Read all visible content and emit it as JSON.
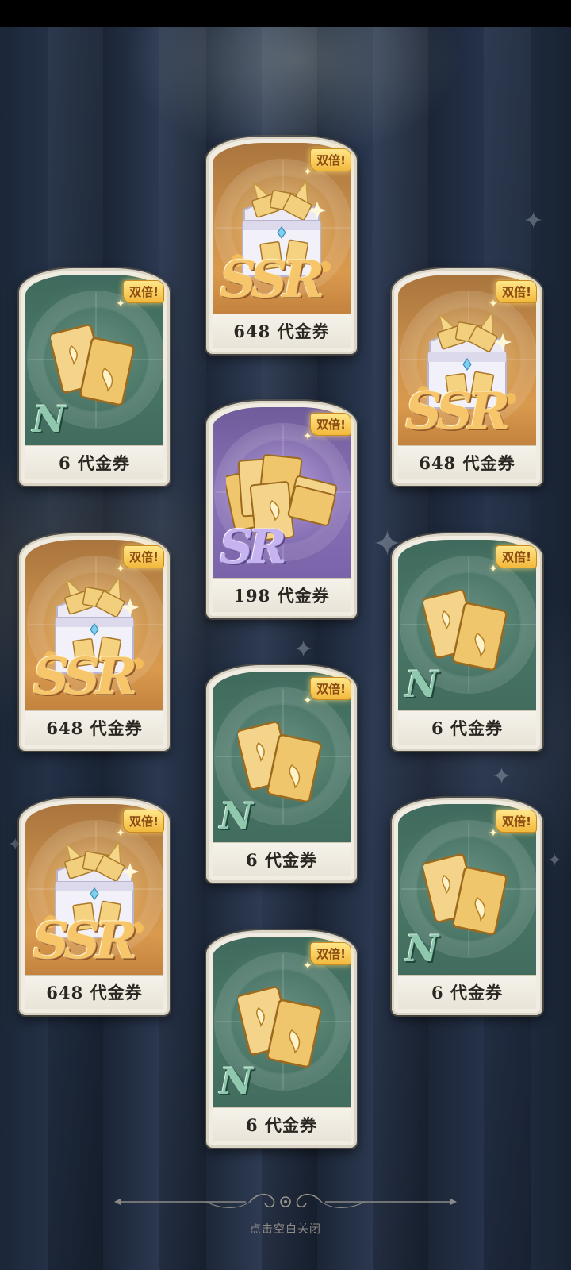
{
  "close_hint": "点击空白关闭",
  "badge_text": "双倍!",
  "colors": {
    "ssr": "#c98f4a",
    "sr": "#8a72b8",
    "n": "#4a7767",
    "badge": "#f2b93c"
  },
  "cards": [
    {
      "id": "card-1",
      "rarity": "SSR",
      "label": "648 代金券",
      "icon": "treasure-chest-icon"
    },
    {
      "id": "card-2",
      "rarity": "N",
      "label": "6 代金券",
      "icon": "ticket-pair-icon"
    },
    {
      "id": "card-3",
      "rarity": "SSR",
      "label": "648 代金券",
      "icon": "treasure-chest-icon"
    },
    {
      "id": "card-4",
      "rarity": "SR",
      "label": "198 代金券",
      "icon": "ticket-stack-icon"
    },
    {
      "id": "card-5",
      "rarity": "SSR",
      "label": "648 代金券",
      "icon": "treasure-chest-icon"
    },
    {
      "id": "card-6",
      "rarity": "N",
      "label": "6 代金券",
      "icon": "ticket-pair-icon"
    },
    {
      "id": "card-7",
      "rarity": "N",
      "label": "6 代金券",
      "icon": "ticket-pair-icon"
    },
    {
      "id": "card-8",
      "rarity": "SSR",
      "label": "648 代金券",
      "icon": "treasure-chest-icon"
    },
    {
      "id": "card-9",
      "rarity": "N",
      "label": "6 代金券",
      "icon": "ticket-pair-icon"
    },
    {
      "id": "card-10",
      "rarity": "N",
      "label": "6 代金券",
      "icon": "ticket-pair-icon"
    }
  ]
}
